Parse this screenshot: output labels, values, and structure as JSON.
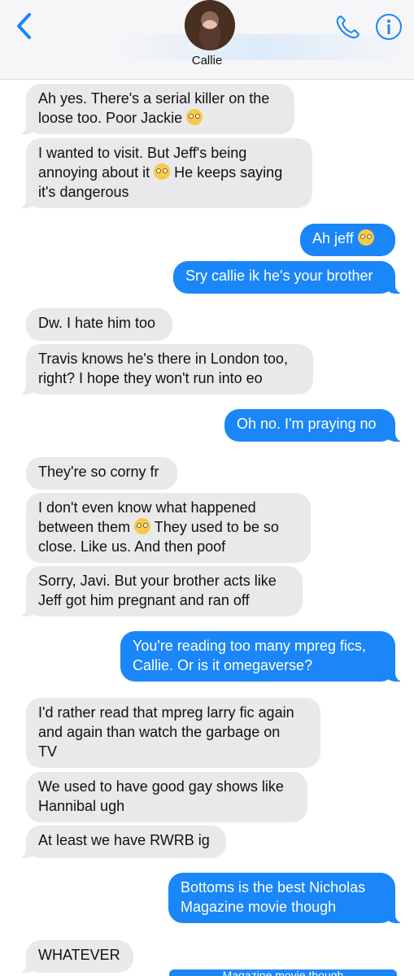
{
  "header": {
    "contact_name": "Callie",
    "back_icon": "chevron-left-icon",
    "phone_icon": "phone-icon",
    "info_icon": "info-icon",
    "accent_color": "#1a86f8"
  },
  "messages": [
    {
      "dir": "in",
      "parts": [
        "Ah yes. There's a serial killer on the\nloose too. Poor Jackie ",
        ""
      ]
    },
    {
      "dir": "in",
      "parts": [
        "I wanted to visit. But Jeff's being\nannoying about it ",
        " He keeps saying\nit's dangerous"
      ]
    },
    {
      "dir": "out",
      "parts": [
        "Ah jeff ",
        ""
      ]
    },
    {
      "dir": "out",
      "parts": [
        "Sry callie ik he's your brother"
      ]
    },
    {
      "dir": "in",
      "parts": [
        "Dw. I hate him too"
      ]
    },
    {
      "dir": "in",
      "parts": [
        "Travis knows he's there in London too,\nright? I hope they won't run into eo"
      ]
    },
    {
      "dir": "out",
      "parts": [
        "Oh no. I'm praying no"
      ]
    },
    {
      "dir": "in",
      "parts": [
        "They're so corny fr"
      ]
    },
    {
      "dir": "in",
      "parts": [
        "I don't even know what happened\nbetween them ",
        " They used to be so\nclose. Like us. And then poof"
      ]
    },
    {
      "dir": "in",
      "parts": [
        "Sorry, Javi. But your brother acts like\nJeff got him pregnant and ran off"
      ]
    },
    {
      "dir": "out",
      "parts": [
        "You're reading too many mpreg fics,\nCallie. Or is it omegaverse?"
      ]
    },
    {
      "dir": "in",
      "parts": [
        "I'd rather read that mpreg larry fic again\nand again than watch the garbage on\nTV"
      ]
    },
    {
      "dir": "in",
      "parts": [
        "We used to have good gay shows like\nHannibal ugh"
      ]
    },
    {
      "dir": "in",
      "parts": [
        "At least we have RWRB ig"
      ]
    },
    {
      "dir": "out",
      "parts": [
        "Bottoms is the best Nicholas\nMagazine movie though"
      ]
    },
    {
      "dir": "in",
      "parts": [
        "WHATEVER"
      ]
    }
  ],
  "bottom_peek": "Magazine movie though"
}
